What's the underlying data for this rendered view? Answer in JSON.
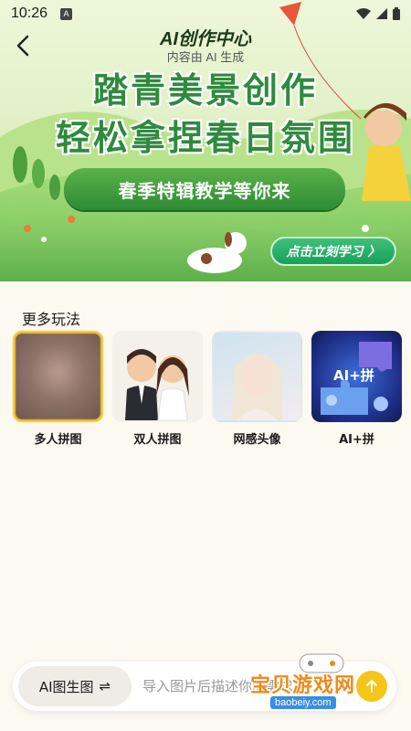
{
  "status_bar": {
    "time": "10:26",
    "notification": "A"
  },
  "header": {
    "title": "AI创作中心",
    "subtitle": "内容由 AI 生成"
  },
  "banner": {
    "headline_line1": "踏青美景创作",
    "headline_line2": "轻松拿捏春日氛围",
    "pill_text": "春季特辑教学等你来",
    "cta_label": "点击立刻学习 〉"
  },
  "more": {
    "title": "更多玩法",
    "items": [
      {
        "label": "多人拼图",
        "selected": true
      },
      {
        "label": "双人拼图",
        "selected": false
      },
      {
        "label": "网感头像",
        "selected": false
      },
      {
        "label": "AI+拼",
        "selected": false
      }
    ],
    "thumb_text": "AI+拼"
  },
  "input_bar": {
    "mode_label": "AI图生图",
    "mode_icon": "⇌",
    "placeholder": "导入图片后描述你的需求"
  },
  "watermark": {
    "text": "宝贝游戏网",
    "url": "baobeiy.com"
  },
  "colors": {
    "accent_yellow": "#f4c430",
    "brand_green": "#2f8a3f",
    "cta_green": "#17a05a"
  }
}
